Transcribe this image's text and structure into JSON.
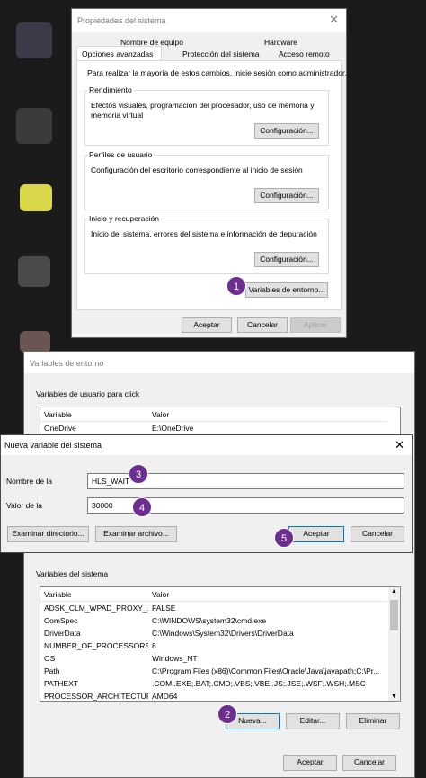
{
  "system_properties": {
    "title": "Propiedades del sistema",
    "tabs_row1": [
      "Nombre de equipo",
      "Hardware"
    ],
    "tabs_row2": [
      "Opciones avanzadas",
      "Protección del sistema",
      "Acceso remoto"
    ],
    "admin_note": "Para realizar la mayoría de estos cambios, inicie sesión como administrador.",
    "performance": {
      "label": "Rendimiento",
      "text": "Efectos visuales, programación del procesador, uso de memoria y memoria virtual",
      "button": "Configuración..."
    },
    "profiles": {
      "label": "Perfiles de usuario",
      "text": "Configuración del escritorio correspondiente al inicio de sesión",
      "button": "Configuración..."
    },
    "startup": {
      "label": "Inicio y recuperación",
      "text": "Inicio del sistema, errores del sistema e información de depuración",
      "button": "Configuración..."
    },
    "env_button": "Variables de entorno...",
    "ok": "Aceptar",
    "cancel": "Cancelar",
    "apply": "Aplicar"
  },
  "env_vars": {
    "title": "Variables de entorno",
    "user_section": "Variables de usuario para click",
    "columns": [
      "Variable",
      "Valor"
    ],
    "user_rows": [
      {
        "var": "OneDrive",
        "val": "E:\\OneDrive"
      }
    ],
    "system_section": "Variables del sistema",
    "system_rows": [
      {
        "var": "ADSK_CLM_WPAD_PROXY_...",
        "val": "FALSE"
      },
      {
        "var": "ComSpec",
        "val": "C:\\WINDOWS\\system32\\cmd.exe"
      },
      {
        "var": "DriverData",
        "val": "C:\\Windows\\System32\\Drivers\\DriverData"
      },
      {
        "var": "NUMBER_OF_PROCESSORS",
        "val": "8"
      },
      {
        "var": "OS",
        "val": "Windows_NT"
      },
      {
        "var": "Path",
        "val": "C:\\Program Files (x86)\\Common Files\\Oracle\\Java\\javapath;C:\\Pr..."
      },
      {
        "var": "PATHEXT",
        "val": ".COM;.EXE;.BAT;.CMD;.VBS;.VBE;.JS;.JSE;.WSF;.WSH;.MSC"
      },
      {
        "var": "PROCESSOR_ARCHITECTURE",
        "val": "AMD64"
      }
    ],
    "new_button": "Nueva...",
    "edit_button": "Editar...",
    "delete_button": "Eliminar",
    "ok": "Aceptar",
    "cancel": "Cancelar"
  },
  "new_var_dialog": {
    "title": "Nueva variable del sistema",
    "name_label": "Nombre de la",
    "name_value": "HLS_WAIT",
    "value_label": "Valor de la",
    "value_value": "30000",
    "browse_dir": "Examinar directorio...",
    "browse_file": "Examinar archivo...",
    "ok": "Aceptar",
    "cancel": "Cancelar"
  },
  "steps": [
    "1",
    "2",
    "3",
    "4",
    "5"
  ],
  "colors": {
    "badge": "#6d2f8f",
    "focus": "#0078d7"
  }
}
